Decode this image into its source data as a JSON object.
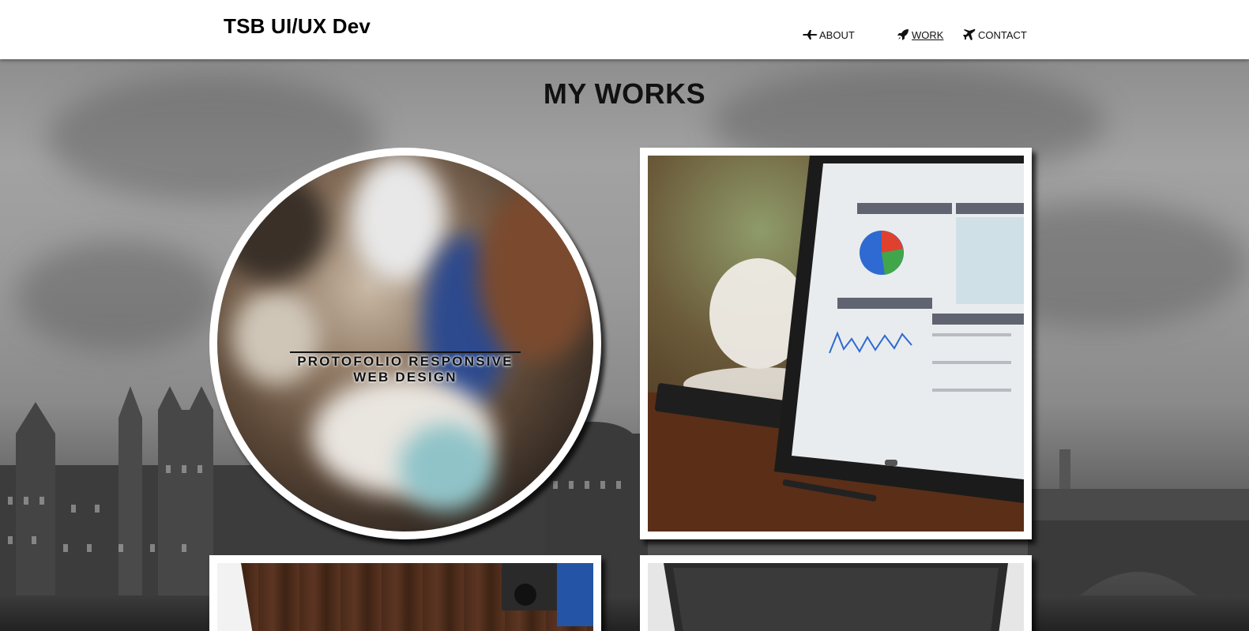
{
  "header": {
    "brand": "TSB UI/UX Dev",
    "nav": [
      {
        "label": "ABOUT",
        "icon": "plane-icon",
        "active": false
      },
      {
        "label": "WORK",
        "icon": "rocket-icon",
        "active": true
      },
      {
        "label": "CONTACT",
        "icon": "airplane-icon",
        "active": false
      }
    ]
  },
  "main": {
    "title": "MY WORKS",
    "cards": [
      {
        "caption": "PROTOFOLIO RESPONSIVE WEB DESIGN",
        "image": "blurred-desk-photo"
      },
      {
        "image": "tablet-analytics-photo"
      },
      {
        "image": "wood-camera-photo"
      },
      {
        "image": "laptop-photo"
      }
    ]
  },
  "colors": {
    "header_bg": "#ffffff",
    "text": "#111111",
    "card_border": "#ffffff"
  }
}
